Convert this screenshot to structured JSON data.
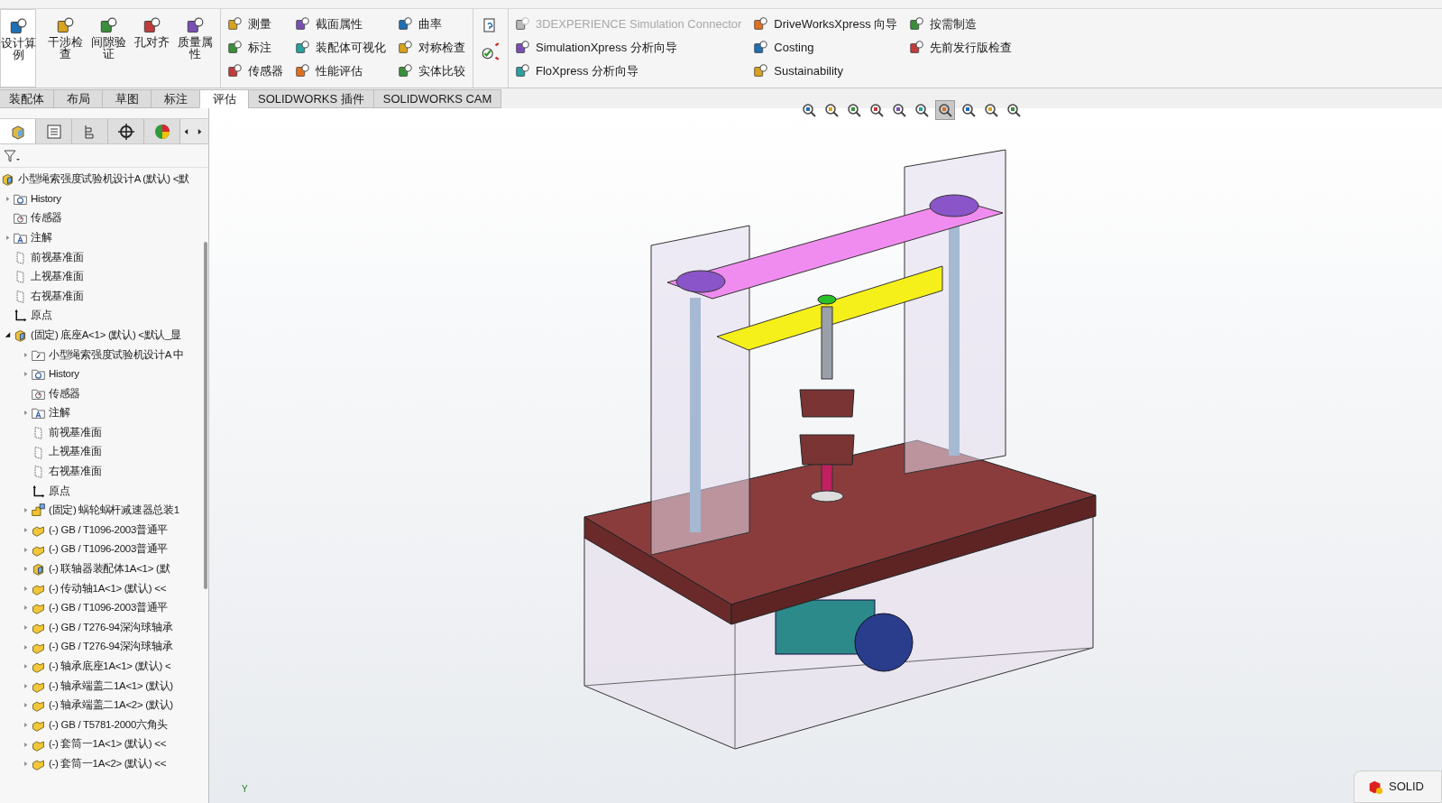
{
  "ribbon": {
    "large_buttons": [
      {
        "label": "设计算例"
      },
      {
        "label": "干涉检查"
      },
      {
        "label": "间隙验证"
      },
      {
        "label": "孔对齐"
      },
      {
        "label": "质量属性"
      }
    ],
    "columns": [
      [
        {
          "label": "测量",
          "disabled": false
        },
        {
          "label": "标注",
          "disabled": false
        },
        {
          "label": "传感器",
          "disabled": false
        }
      ],
      [
        {
          "label": "截面属性",
          "disabled": false
        },
        {
          "label": "装配体可视化",
          "disabled": false
        },
        {
          "label": "性能评估",
          "disabled": false
        }
      ],
      [
        {
          "label": "曲率",
          "disabled": false
        },
        {
          "label": "对称检查",
          "disabled": false
        },
        {
          "label": "实体比较",
          "disabled": false
        }
      ],
      [
        {
          "label": "3DEXPERIENCE Simulation Connector",
          "disabled": true
        },
        {
          "label": "SimulationXpress 分析向导",
          "disabled": false
        },
        {
          "label": "FloXpress 分析向导",
          "disabled": false
        }
      ],
      [
        {
          "label": "DriveWorksXpress 向导",
          "disabled": false
        },
        {
          "label": "Costing",
          "disabled": false
        },
        {
          "label": "Sustainability",
          "disabled": false
        }
      ],
      [
        {
          "label": "按需制造",
          "disabled": false
        },
        {
          "label": "先前发行版检查",
          "disabled": false
        }
      ]
    ]
  },
  "tabs": [
    {
      "label": "装配体",
      "selected": false
    },
    {
      "label": "布局",
      "selected": false
    },
    {
      "label": "草图",
      "selected": false
    },
    {
      "label": "标注",
      "selected": false
    },
    {
      "label": "评估",
      "selected": true
    },
    {
      "label": "SOLIDWORKS 插件",
      "selected": false
    },
    {
      "label": "SOLIDWORKS CAM",
      "selected": false
    }
  ],
  "panel_tabs": [
    {
      "selected": true
    },
    {
      "selected": false
    },
    {
      "selected": false
    },
    {
      "selected": false
    },
    {
      "selected": false
    }
  ],
  "tree": [
    {
      "label": "小型绳索强度试验机设计A (默认) <默",
      "kind": "assembly",
      "children": [
        {
          "label": "History",
          "kind": "history",
          "expanded": false
        },
        {
          "label": "传感器",
          "kind": "sensor"
        },
        {
          "label": "注解",
          "kind": "annotation",
          "expanded": false
        },
        {
          "label": "前视基准面",
          "kind": "plane"
        },
        {
          "label": "上视基准面",
          "kind": "plane"
        },
        {
          "label": "右视基准面",
          "kind": "plane"
        },
        {
          "label": "原点",
          "kind": "origin"
        },
        {
          "label": "(固定) 底座A<1> (默认) <默认_显",
          "kind": "assembly",
          "expanded": true,
          "children": [
            {
              "label": "小型绳索强度试验机设计A 中",
              "kind": "reference",
              "expanded": false
            },
            {
              "label": "History",
              "kind": "history",
              "expanded": false
            },
            {
              "label": "传感器",
              "kind": "sensor"
            },
            {
              "label": "注解",
              "kind": "annotation",
              "expanded": false
            },
            {
              "label": "前视基准面",
              "kind": "plane"
            },
            {
              "label": "上视基准面",
              "kind": "plane"
            },
            {
              "label": "右视基准面",
              "kind": "plane"
            },
            {
              "label": "原点",
              "kind": "origin"
            },
            {
              "label": "(固定) 蜗轮蜗杆减速器总装1",
              "kind": "subassembly",
              "expanded": false
            },
            {
              "label": "(-) GB / T1096-2003普通平",
              "kind": "part",
              "expanded": false
            },
            {
              "label": "(-) GB / T1096-2003普通平",
              "kind": "part",
              "expanded": false
            },
            {
              "label": "(-) 联轴器装配体1A<1> (默",
              "kind": "assembly",
              "expanded": false
            },
            {
              "label": "(-) 传动轴1A<1> (默认) <<",
              "kind": "part",
              "expanded": false
            },
            {
              "label": "(-) GB / T1096-2003普通平",
              "kind": "part",
              "expanded": false
            },
            {
              "label": "(-) GB / T276-94深沟球轴承",
              "kind": "part",
              "expanded": false
            },
            {
              "label": "(-) GB / T276-94深沟球轴承",
              "kind": "part",
              "expanded": false
            },
            {
              "label": "(-) 轴承底座1A<1> (默认) <",
              "kind": "part",
              "expanded": false
            },
            {
              "label": "(-) 轴承端盖二1A<1> (默认)",
              "kind": "part",
              "expanded": false
            },
            {
              "label": "(-) 轴承端盖二1A<2> (默认)",
              "kind": "part",
              "expanded": false
            },
            {
              "label": "(-) GB / T5781-2000六角头",
              "kind": "part",
              "expanded": false
            },
            {
              "label": "(-) 套筒一1A<1> (默认) <<",
              "kind": "part",
              "expanded": false
            },
            {
              "label": "(-) 套筒一1A<2> (默认) <<",
              "kind": "part",
              "expanded": false
            }
          ]
        }
      ]
    }
  ],
  "triad_label": "Y",
  "notification": {
    "title": "SOLID"
  }
}
